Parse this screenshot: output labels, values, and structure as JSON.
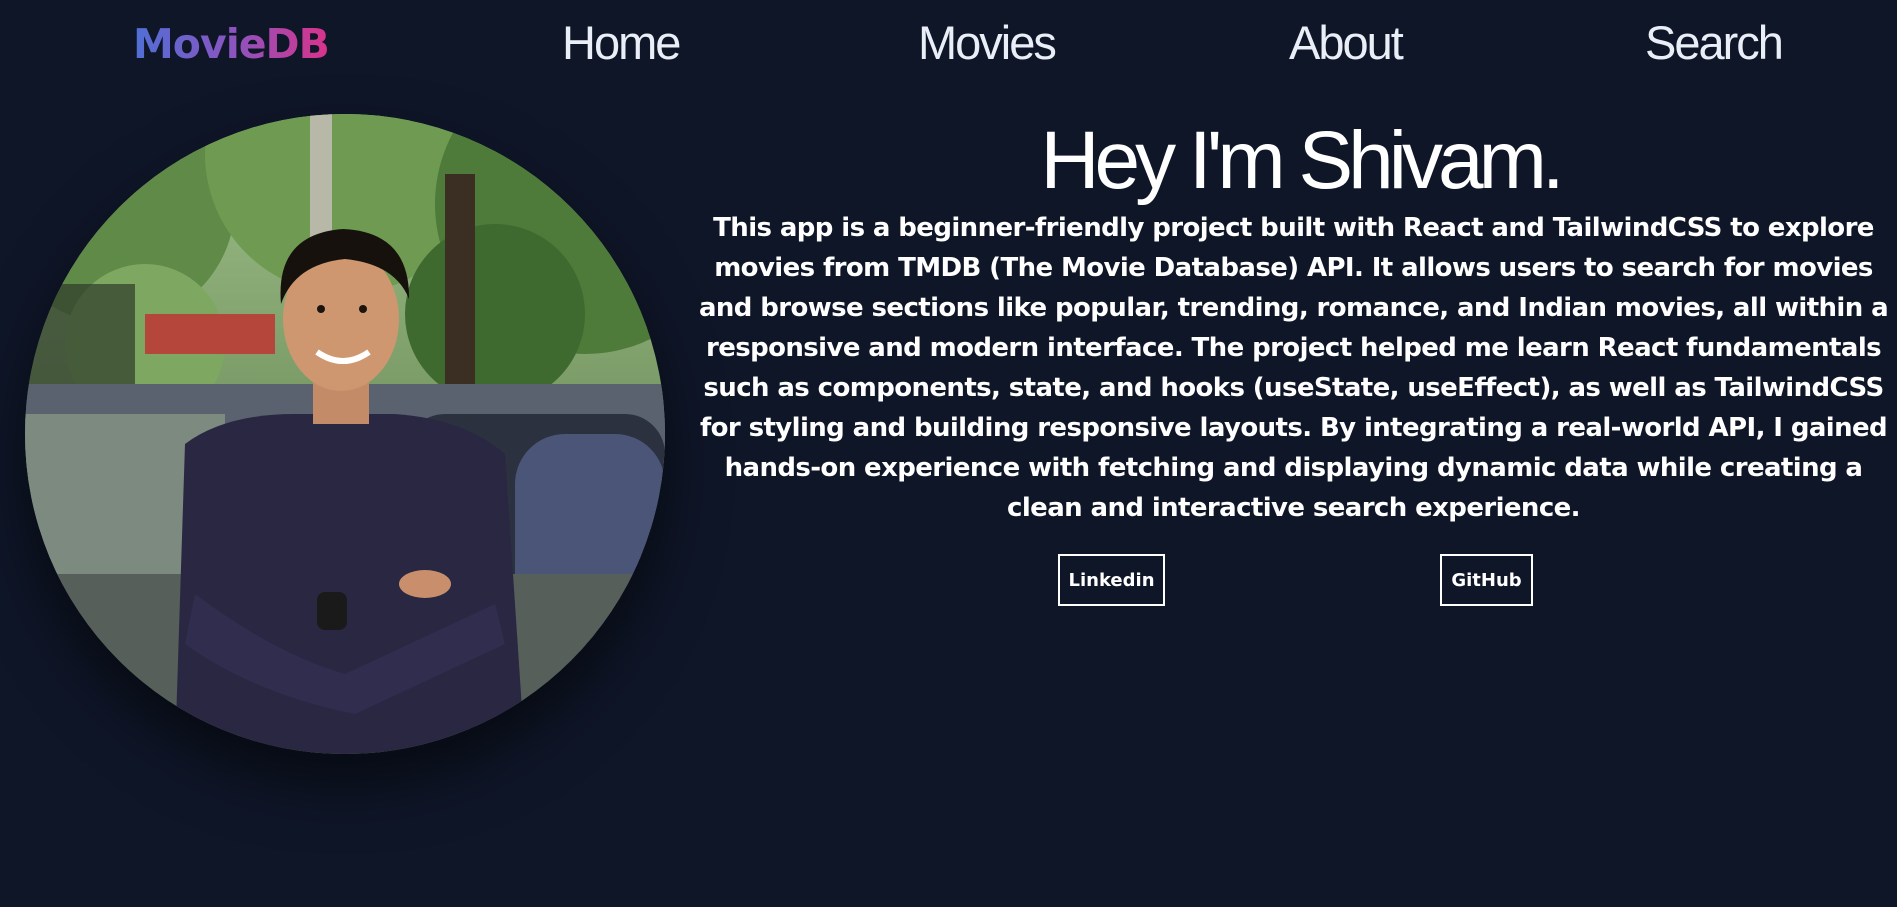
{
  "nav": {
    "logo": "MovieDB",
    "links": [
      "Home",
      "Movies",
      "About",
      "Search"
    ]
  },
  "profile": {
    "photo_alt": "Shivam",
    "heading": "Hey I'm Shivam.",
    "description": "This app is a beginner-friendly project built with React and TailwindCSS to explore movies from TMDB (The Movie Database) API. It allows users to search for movies and browse sections like popular, trending, romance, and Indian movies, all within a responsive and modern interface. The project helped me learn React fundamentals such as components, state, and hooks (useState, useEffect), as well as TailwindCSS for styling and building responsive layouts. By integrating a real-world API, I gained hands-on experience with fetching and displaying dynamic data while creating a clean and interactive search experience."
  },
  "buttons": {
    "linkedin": "Linkedin",
    "github": "GitHub"
  },
  "colors": {
    "background": "#0f1628",
    "logo_gradient_start": "#4f6fd6",
    "logo_gradient_end": "#d9338a",
    "text": "#ffffff"
  }
}
